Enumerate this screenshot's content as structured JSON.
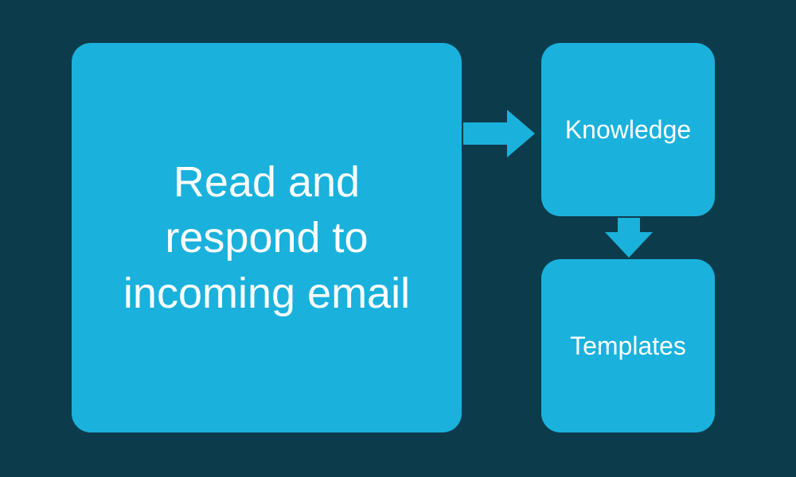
{
  "diagram": {
    "main_box": "Read and respond to incoming email",
    "knowledge_box": "Knowledge",
    "templates_box": "Templates"
  },
  "colors": {
    "background": "#0c3c4c",
    "box_fill": "#1ab2dc",
    "text": "#ffffff"
  }
}
